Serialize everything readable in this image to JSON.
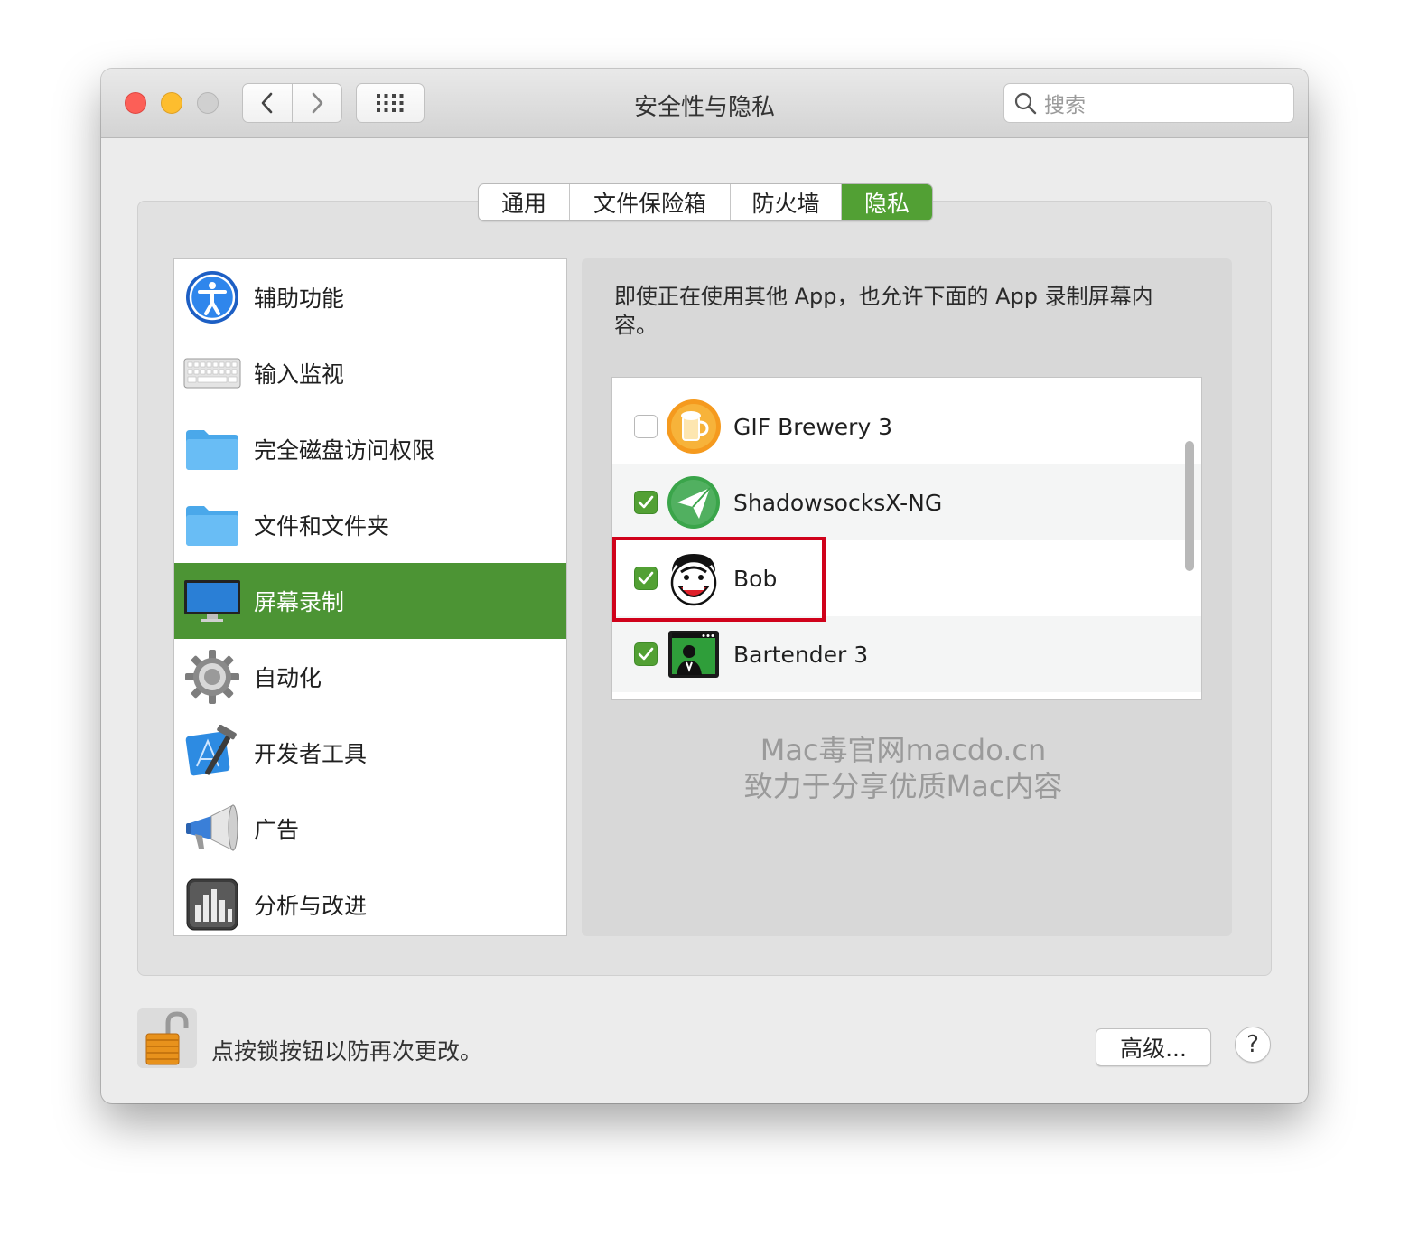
{
  "window": {
    "title": "安全性与隐私"
  },
  "search": {
    "placeholder": "搜索"
  },
  "tabs": [
    {
      "label": "通用",
      "active": false
    },
    {
      "label": "文件保险箱",
      "active": false
    },
    {
      "label": "防火墙",
      "active": false
    },
    {
      "label": "隐私",
      "active": true
    }
  ],
  "sidebar": {
    "items": [
      {
        "label": "辅助功能",
        "icon": "accessibility-icon"
      },
      {
        "label": "输入监视",
        "icon": "keyboard-icon"
      },
      {
        "label": "完全磁盘访问权限",
        "icon": "folder-icon"
      },
      {
        "label": "文件和文件夹",
        "icon": "folder-icon"
      },
      {
        "label": "屏幕录制",
        "icon": "display-icon",
        "selected": true
      },
      {
        "label": "自动化",
        "icon": "gear-icon"
      },
      {
        "label": "开发者工具",
        "icon": "xcode-icon"
      },
      {
        "label": "广告",
        "icon": "megaphone-icon"
      },
      {
        "label": "分析与改进",
        "icon": "chart-icon"
      }
    ]
  },
  "main": {
    "description": "即使正在使用其他 App，也允许下面的 App 录制屏幕内容。",
    "apps": [
      {
        "name": "GIF Brewery 3",
        "checked": false,
        "icon": "gif-brewery-icon"
      },
      {
        "name": "ShadowsocksX-NG",
        "checked": true,
        "icon": "paper-plane-icon"
      },
      {
        "name": "Bob",
        "checked": true,
        "icon": "bob-face-icon"
      },
      {
        "name": "Bartender 3",
        "checked": true,
        "icon": "bartender-icon"
      }
    ]
  },
  "watermark": {
    "line1": "Mac毒官网macdo.cn",
    "line2": "致力于分享优质Mac内容"
  },
  "footer": {
    "lock_text": "点按锁按钮以防再次更改。",
    "advanced_label": "高级...",
    "help_label": "?"
  },
  "colors": {
    "accent_green": "#52a034",
    "highlight_red": "#d0021b"
  }
}
